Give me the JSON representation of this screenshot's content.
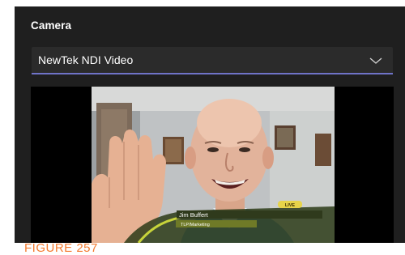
{
  "section": {
    "title": "Camera"
  },
  "camera_select": {
    "value": "NewTek NDI Video",
    "icon": "chevron-down-icon"
  },
  "preview": {
    "lower_third_name": "Jim Buffert",
    "lower_third_subtitle": "TLP/Marketing",
    "live_label": "LIVE"
  },
  "caption": "FIGURE 257",
  "colors": {
    "panel_bg": "#1f1f1f",
    "select_bg": "#2b2b2b",
    "select_underline": "#6f73c8",
    "caption": "#f47a2e"
  }
}
